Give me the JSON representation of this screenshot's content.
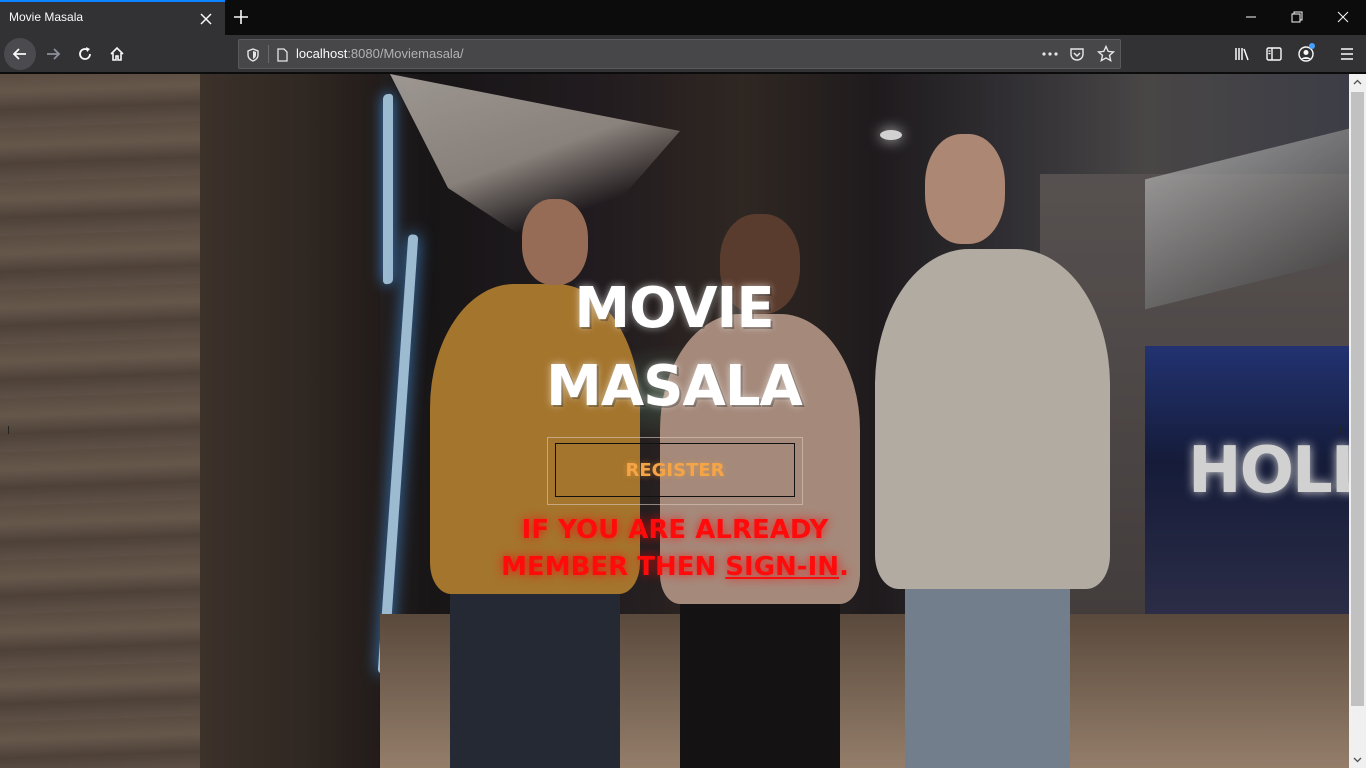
{
  "browser": {
    "tab_title": "Movie Masala",
    "url_host": "localhost",
    "url_rest": ":8080/Moviemasala/",
    "icons": {
      "tab_close": "close-icon",
      "new_tab": "plus-icon",
      "back": "arrow-left-icon",
      "forward": "arrow-right-icon",
      "reload": "reload-icon",
      "home": "home-icon",
      "tracking": "shield-icon",
      "page_info": "page-icon",
      "page_actions": "ellipsis-icon",
      "pocket": "pocket-icon",
      "bookmark": "star-icon",
      "library": "library-icon",
      "sidebar": "sidebar-icon",
      "account": "account-icon",
      "menu": "hamburger-icon"
    },
    "accent_color": "#0a84ff"
  },
  "page": {
    "title_line1": "MOVIE",
    "title_line2": "MASALA",
    "register_label": "REGISTER",
    "signin_prefix": "IF YOU ARE ALREADY MEMBER THEN ",
    "signin_link": "SIGN-IN",
    "signin_suffix": ".",
    "colors": {
      "title": "#ffffff",
      "register": "#f5a545",
      "signin": "#ff0b0b"
    }
  }
}
